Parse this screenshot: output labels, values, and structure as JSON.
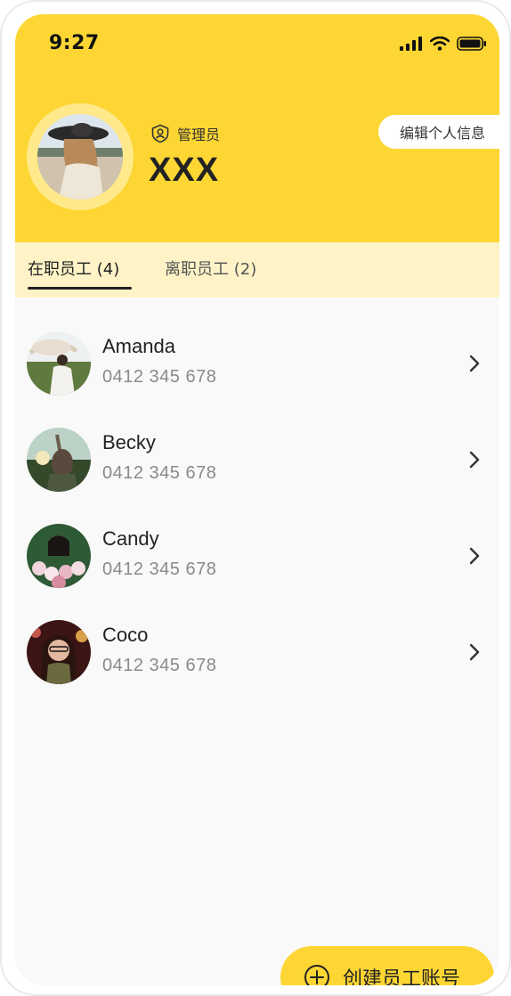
{
  "status_bar": {
    "time": "9:27",
    "icons": [
      "signal-icon",
      "wifi-icon",
      "battery-icon"
    ]
  },
  "profile": {
    "role": "管理员",
    "name": "XXX",
    "edit_label": "编辑个人信息",
    "role_icon": "admin-badge-icon"
  },
  "tabs": [
    {
      "label": "在职员工 (4)",
      "active": true
    },
    {
      "label": "离职员工 (2)",
      "active": false
    }
  ],
  "employees": [
    {
      "name": "Amanda",
      "phone": "0412 345 678"
    },
    {
      "name": "Becky",
      "phone": "0412 345 678"
    },
    {
      "name": "Candy",
      "phone": "0412 345 678"
    },
    {
      "name": "Coco",
      "phone": "0412 345 678"
    }
  ],
  "create_button": {
    "label": "创建员工账号",
    "icon": "plus-circle-icon"
  },
  "colors": {
    "accent": "#fdd634",
    "tab_bg": "#fdf3c7",
    "avatar_ring": "#ffe98b",
    "list_bg": "#f9f9f9"
  }
}
